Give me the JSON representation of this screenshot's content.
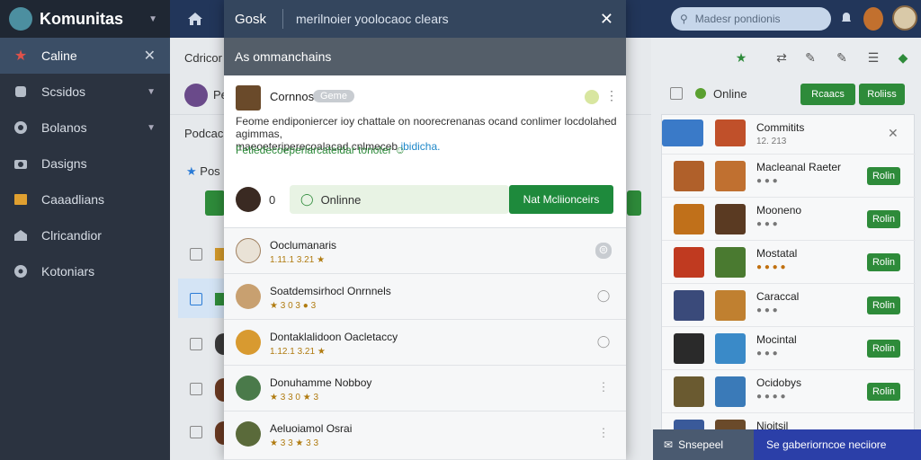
{
  "app": {
    "title": "Komunitas"
  },
  "sidebar": {
    "items": [
      {
        "label": "Caline",
        "icon": "star-icon"
      },
      {
        "label": "Scsidos",
        "icon": "shield-icon"
      },
      {
        "label": "Bolanos",
        "icon": "gear-icon"
      },
      {
        "label": "Dasigns",
        "icon": "camera-icon"
      },
      {
        "label": "Caaadlians",
        "icon": "folder-icon"
      },
      {
        "label": "Clricandior",
        "icon": "store-icon"
      },
      {
        "label": "Kotoniars",
        "icon": "settings-icon"
      }
    ]
  },
  "topbar": {
    "search_placeholder": "Madesr pondionis"
  },
  "background": {
    "header_text": "Cdricor",
    "row1_label": "Pe",
    "row2_label": "Podcac",
    "row3_label": "Pos"
  },
  "right_panel": {
    "online_label": "Online",
    "btn1": "Rcaacs",
    "btn2": "Roliiss",
    "card_title": "Commitits",
    "card_sub": "12. 213",
    "items": [
      {
        "name": "Macleanal Raeter",
        "sub": "● ● ●",
        "btn": "Rolin"
      },
      {
        "name": "Mooneno",
        "sub": "● ● ●",
        "btn": "Rolin"
      },
      {
        "name": "Mostatal",
        "sub": "● ● ● ●",
        "btn": "Rolin"
      },
      {
        "name": "Caraccal",
        "sub": "● ● ●",
        "btn": "Rolin"
      },
      {
        "name": "Mocintal",
        "sub": "● ● ●",
        "btn": "Rolin"
      },
      {
        "name": "Ocidobys",
        "sub": "● ● ● ●",
        "btn": "Rolin"
      },
      {
        "name": "Nioitsil",
        "sub": "● ● ●",
        "btn": "Rolin"
      }
    ]
  },
  "modal": {
    "title": "Gosk",
    "subtitle": "merilnoier yoolocaoc clears",
    "section_title": "As ommanchains",
    "post": {
      "author": "Cornnos",
      "tag": "Geme",
      "text": "Feome endiponiercer ioy chattale on noorecrenanas ocand conlimer locdolahed agimmas,",
      "text_line2": "maeoeteriperecoalacad cnlmeceb",
      "link": "ibidicha.",
      "tags": "Fetiedecoeperiarcateidar tonoter ☺"
    },
    "status": {
      "count": "0",
      "label": "Onlinne",
      "button": "Nat Mcliionceirs"
    },
    "items": [
      {
        "name": "Ooclumanaris",
        "meta": "1.11.1 3.21 ★"
      },
      {
        "name": "Soatdemsirhocl Onrnnels",
        "meta": "★ 3 0 3 ● 3"
      },
      {
        "name": "Dontaklalidoon Oacletaccy",
        "meta": "1.12.1 3.21 ★"
      },
      {
        "name": "Donuhamme Nobboy",
        "meta": "★ 3 3 0 ★ 3"
      },
      {
        "name": "Aeluoiamol Osrai",
        "meta": "★ 3 3 ★ 3 3"
      }
    ]
  },
  "notice": {
    "left": "Snsepeel",
    "right": "Se gaberiorncoe neciiore"
  },
  "colors": {
    "sidebar": "#2b3340",
    "topbar": "#22365a",
    "accent_green": "#2e8b3a",
    "link": "#1f88c9"
  }
}
